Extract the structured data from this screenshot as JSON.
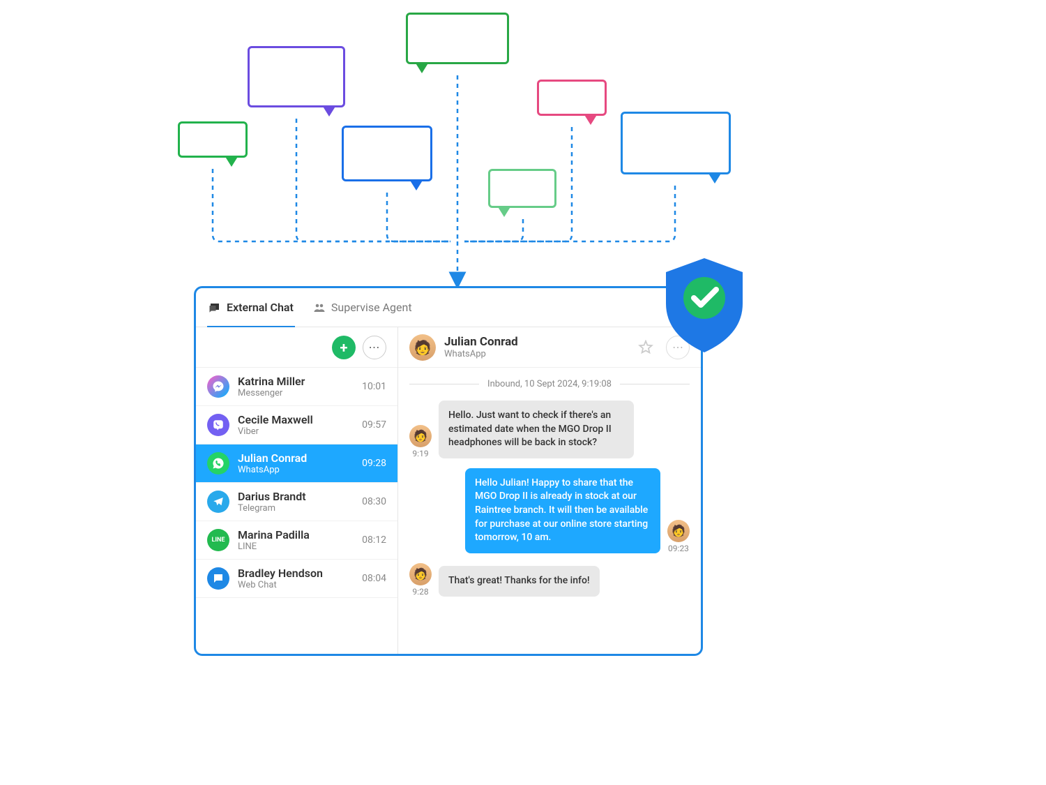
{
  "colors": {
    "primary": "#1e88e5",
    "selected": "#1ea8ff",
    "add_btn": "#1fba66"
  },
  "tabs": [
    {
      "label": "External Chat",
      "icon": "chat-bubble-icon",
      "active": true
    },
    {
      "label": "Supervise Agent",
      "icon": "agent-group-icon",
      "active": false
    }
  ],
  "conversations": [
    {
      "name": "Katrina Miller",
      "channel": "Messenger",
      "time": "10:01",
      "icon": "messenger",
      "selected": false
    },
    {
      "name": "Cecile Maxwell",
      "channel": "Viber",
      "time": "09:57",
      "icon": "viber",
      "selected": false
    },
    {
      "name": "Julian Conrad",
      "channel": "WhatsApp",
      "time": "09:28",
      "icon": "whatsapp",
      "selected": true
    },
    {
      "name": "Darius Brandt",
      "channel": "Telegram",
      "time": "08:30",
      "icon": "telegram",
      "selected": false
    },
    {
      "name": "Marina Padilla",
      "channel": "LINE",
      "time": "08:12",
      "icon": "line",
      "selected": false
    },
    {
      "name": "Bradley Hendson",
      "channel": "Web Chat",
      "time": "08:04",
      "icon": "webchat",
      "selected": false
    }
  ],
  "chat_header": {
    "name": "Julian Conrad",
    "channel": "WhatsApp"
  },
  "chat_divider": "Inbound, 10 Sept 2024, 9:19:08",
  "messages": [
    {
      "dir": "in",
      "time": "9:19",
      "text": "Hello. Just want to check if there's an estimated date when the MGO Drop II headphones will be back in stock?"
    },
    {
      "dir": "out",
      "time": "09:23",
      "text": "Hello Julian! Happy to share that the MGO Drop II is already in stock at our Raintree branch. It will then be available for purchase at our online store starting tomorrow, 10 am."
    },
    {
      "dir": "in",
      "time": "9:28",
      "text": "That's great! Thanks for the info!"
    }
  ],
  "shield": {
    "shield_color": "#1e78e5",
    "check_bg": "#1fba66"
  },
  "diagram_bubbles": [
    {
      "color": "#22b24c"
    },
    {
      "color": "#6b4ce0"
    },
    {
      "color": "#28a745"
    },
    {
      "color": "#1a6fe8"
    },
    {
      "color": "#66cc88"
    },
    {
      "color": "#e64980"
    },
    {
      "color": "#1e88e5"
    }
  ]
}
